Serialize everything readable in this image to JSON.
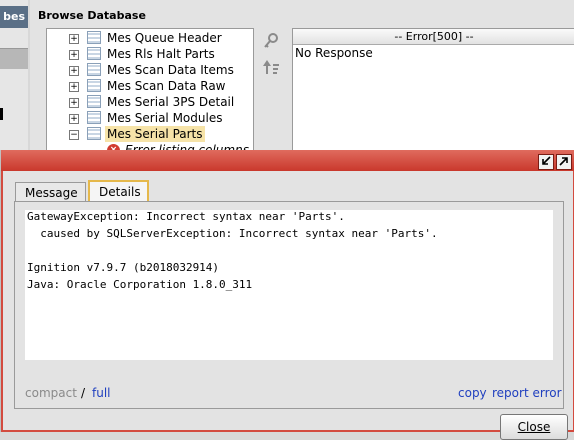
{
  "left_panel": {
    "tab_label": "bes"
  },
  "browse": {
    "title": "Browse Database",
    "tree": [
      {
        "label": "Mes Queue Header",
        "expander": "+"
      },
      {
        "label": "Mes Rls Halt Parts",
        "expander": "+"
      },
      {
        "label": "Mes Scan Data Items",
        "expander": "+"
      },
      {
        "label": "Mes Scan Data Raw",
        "expander": "+"
      },
      {
        "label": "Mes Serial 3PS Detail",
        "expander": "+"
      },
      {
        "label": "Mes Serial Modules",
        "expander": "+"
      },
      {
        "label": "Mes Serial Parts",
        "expander": "−",
        "selected": true
      }
    ],
    "tree_child": {
      "label": "Error listing columns"
    },
    "results": {
      "header": "-- Error[500] --",
      "cell": "No Response"
    }
  },
  "dialog": {
    "tabs": {
      "message": "Message",
      "details": "Details"
    },
    "details_lines": [
      "GatewayException: Incorrect syntax near 'Parts'.",
      "  caused by SQLServerException: Incorrect syntax near 'Parts'.",
      "",
      "Ignition v7.9.7 (b2018032914)",
      "Java: Oracle Corporation 1.8.0_311"
    ],
    "links": {
      "compact": "compact",
      "separator": "/",
      "full": "full",
      "copy": "copy",
      "report": "report error"
    },
    "close_label": "Close"
  },
  "colors": {
    "titlebar": "#d9564a",
    "selected_tab_border": "#e5b84b",
    "link": "#1f3fbf",
    "selection": "#f6e3a8"
  },
  "icons": [
    "table-icon",
    "error-icon",
    "key-icon",
    "sort-icon",
    "restore-icon",
    "maximize-icon"
  ]
}
